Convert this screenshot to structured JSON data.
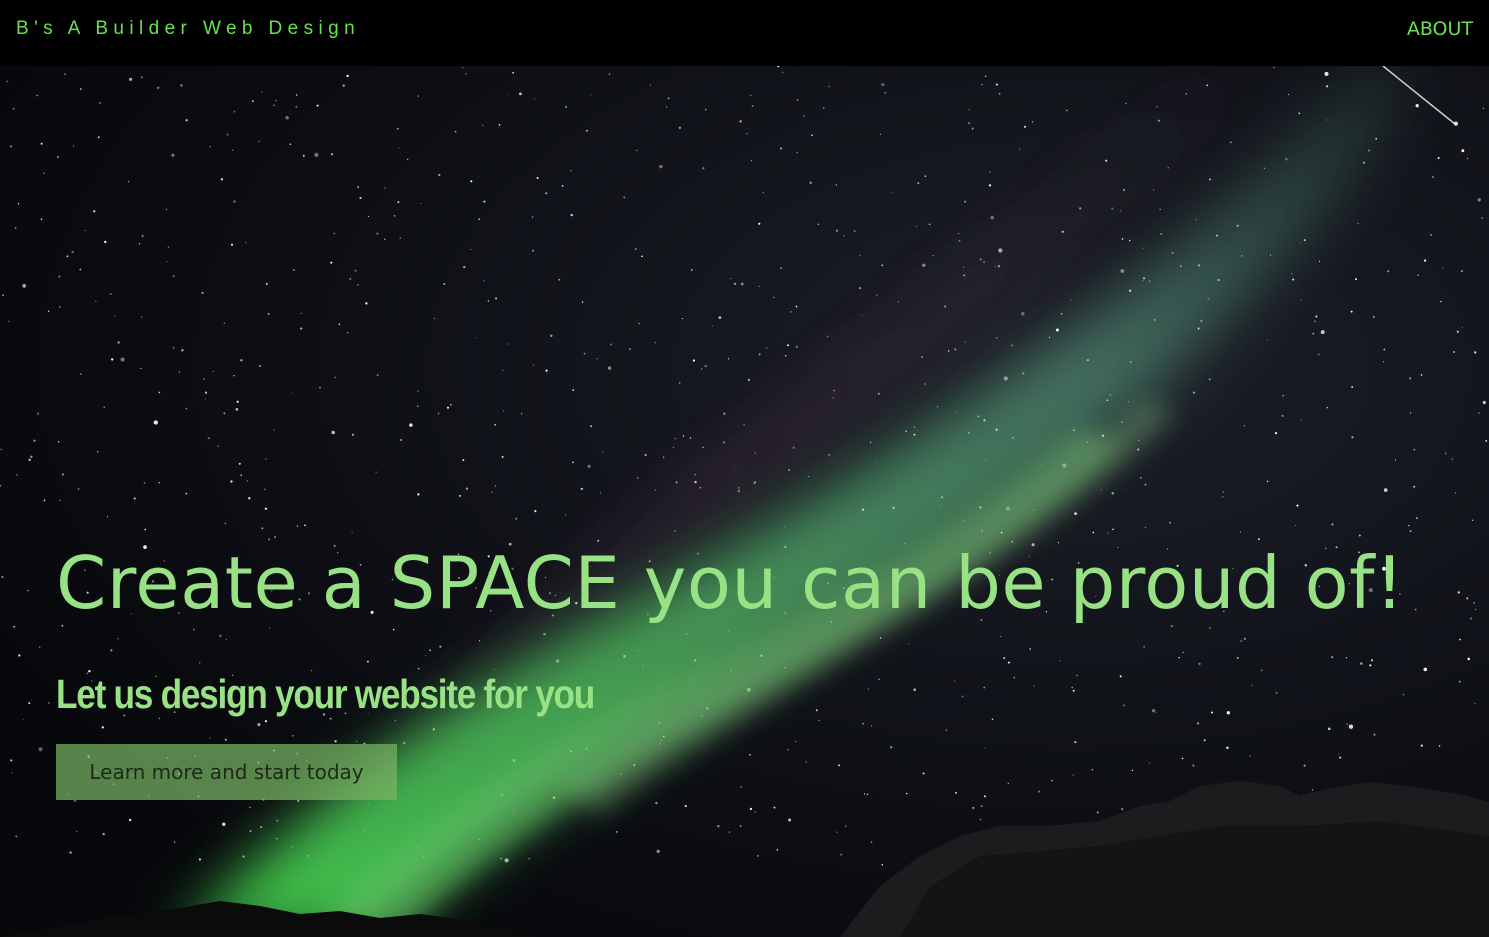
{
  "header": {
    "brand": "B's A Builder Web Design",
    "nav": [
      {
        "label": "ABOUT"
      }
    ]
  },
  "hero": {
    "headline": "Create a SPACE you can be proud of!",
    "subheadline": "Let us design your website for you",
    "cta_label": "Learn more and start today"
  },
  "colors": {
    "accent_green": "#66e24d",
    "headline_green": "#98e184",
    "cta_background": "#78b464",
    "page_background": "#000000"
  }
}
